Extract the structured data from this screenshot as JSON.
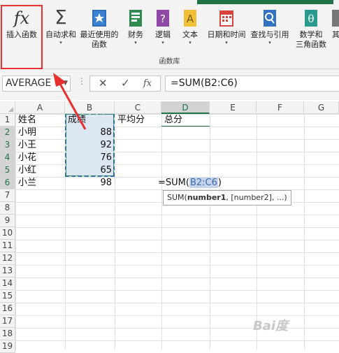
{
  "ribbon": {
    "buttons": [
      {
        "label": "插入函数",
        "icon": "fx-icon"
      },
      {
        "label": "自动求和",
        "icon": "sigma-icon",
        "has_menu": true
      },
      {
        "label": "最近使用的",
        "label2": "函数",
        "icon": "star-book-icon",
        "has_menu": true
      },
      {
        "label": "财务",
        "icon": "finance-book-icon",
        "has_menu": true
      },
      {
        "label": "逻辑",
        "icon": "logic-book-icon",
        "has_menu": true
      },
      {
        "label": "文本",
        "icon": "text-book-icon",
        "has_menu": true
      },
      {
        "label": "日期和时间",
        "icon": "calendar-icon",
        "has_menu": true
      },
      {
        "label": "查找与引用",
        "icon": "lookup-book-icon",
        "has_menu": true
      },
      {
        "label": "数学和",
        "label2": "三角函数",
        "icon": "math-book-icon",
        "has_menu": true
      },
      {
        "label": "其",
        "icon": "more-icon"
      }
    ],
    "group_label": "函数库",
    "arrow_glyph": "▾"
  },
  "formula_bar": {
    "name_box": "AVERAGE",
    "cancel_glyph": "✕",
    "enter_glyph": "✓",
    "fx_glyph": "fx",
    "formula": "=SUM(B2:C6)"
  },
  "grid": {
    "columns": [
      "A",
      "B",
      "C",
      "D",
      "E",
      "F",
      "G"
    ],
    "rows": [
      "1",
      "2",
      "3",
      "4",
      "5",
      "6",
      "7",
      "8",
      "9",
      "10",
      "11",
      "12",
      "13",
      "14",
      "15",
      "16",
      "17",
      "18",
      "19"
    ],
    "headers": {
      "A1": "姓名",
      "B1": "成绩",
      "C1": "平均分",
      "D1": "总分"
    },
    "names": [
      "小明",
      "小王",
      "小花",
      "小红",
      "小兰"
    ],
    "scores": [
      "88",
      "92",
      "76",
      "65",
      "98"
    ],
    "edit_cell": {
      "prefix": "=SUM(",
      "ref": "B2:C6",
      "suffix": ")"
    },
    "tooltip": {
      "fn": "SUM(",
      "arg1": "number1",
      "rest": ", [number2], ...)"
    }
  },
  "colors": {
    "accent": "#217346",
    "highlight": "#e8312f",
    "range": "#3a6db3"
  },
  "watermark": "Bai度"
}
